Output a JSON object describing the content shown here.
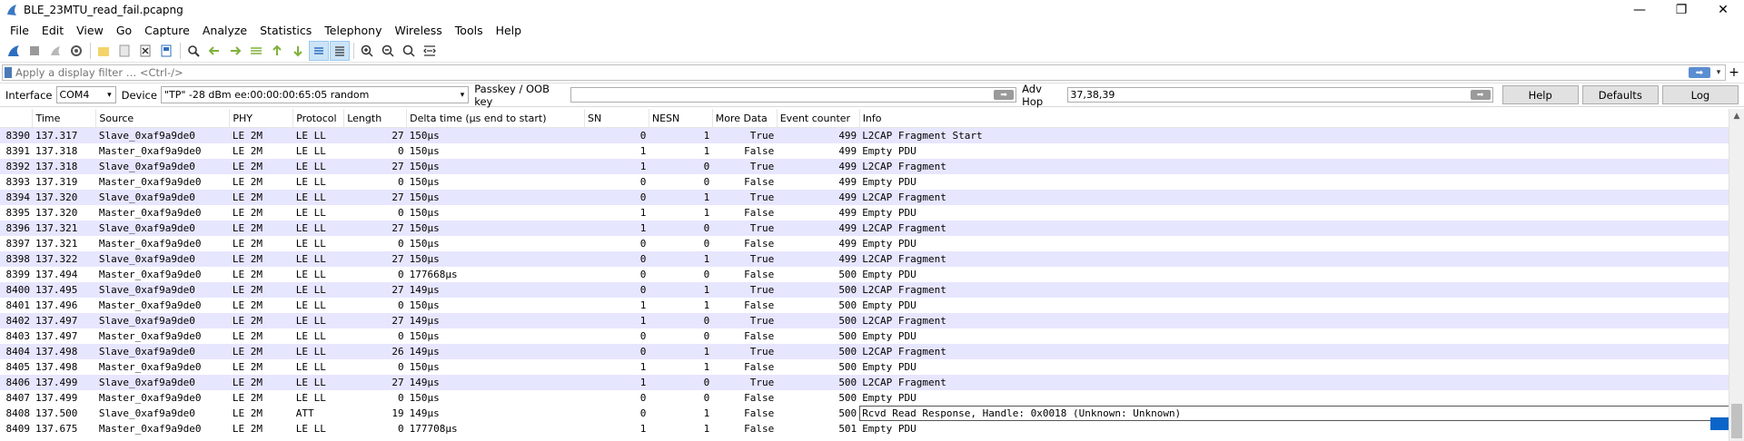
{
  "window": {
    "title": "BLE_23MTU_read_fail.pcapng",
    "controls": {
      "minimize": "—",
      "restore": "❐",
      "close": "✕"
    }
  },
  "menu": [
    "File",
    "Edit",
    "View",
    "Go",
    "Capture",
    "Analyze",
    "Statistics",
    "Telephony",
    "Wireless",
    "Tools",
    "Help"
  ],
  "toolbar": {
    "icons": [
      "shark-fin-start-icon",
      "stop-square-icon",
      "restart-icon",
      "options-gear-icon",
      "open-folder-icon",
      "save-file-icon",
      "close-file-icon",
      "reload-icon",
      "find-icon",
      "go-back-icon",
      "go-forward-icon",
      "go-to-packet-icon",
      "go-first-icon",
      "go-last-icon",
      "autoscroll-icon",
      "colorize-icon",
      "zoom-in-icon",
      "zoom-out-icon",
      "zoom-reset-icon",
      "resize-columns-icon"
    ]
  },
  "filter": {
    "placeholder": "Apply a display filter … <Ctrl-/>",
    "apply_arrow": "➡",
    "dropdown": "▾",
    "add": "+"
  },
  "interface_bar": {
    "interface_label": "Interface",
    "interface_value": "COM4",
    "device_label": "Device",
    "device_value": "\"TP\"  -28 dBm  ee:00:00:00:65:05  random",
    "passkey_label": "Passkey / OOB key",
    "passkey_value": "",
    "adv_hop_label": "Adv Hop",
    "adv_hop_value": "37,38,39",
    "help_button": "Help",
    "defaults_button": "Defaults",
    "log_button": "Log",
    "arrow": "➡"
  },
  "packet_list": {
    "columns": [
      "",
      "Time",
      "Source",
      "PHY",
      "Protocol",
      "Length",
      "Delta time (µs end to start)",
      "SN",
      "NESN",
      "More Data",
      "Event counter",
      "Info"
    ],
    "rows": [
      [
        "8390",
        "137.317",
        "Slave_0xaf9a9de0",
        "LE 2M",
        "LE LL",
        "27",
        "150µs",
        "0",
        "1",
        "True",
        "499",
        "L2CAP Fragment Start"
      ],
      [
        "8391",
        "137.318",
        "Master_0xaf9a9de0",
        "LE 2M",
        "LE LL",
        "0",
        "150µs",
        "1",
        "1",
        "False",
        "499",
        "Empty PDU"
      ],
      [
        "8392",
        "137.318",
        "Slave_0xaf9a9de0",
        "LE 2M",
        "LE LL",
        "27",
        "150µs",
        "1",
        "0",
        "True",
        "499",
        "L2CAP Fragment"
      ],
      [
        "8393",
        "137.319",
        "Master_0xaf9a9de0",
        "LE 2M",
        "LE LL",
        "0",
        "150µs",
        "0",
        "0",
        "False",
        "499",
        "Empty PDU"
      ],
      [
        "8394",
        "137.320",
        "Slave_0xaf9a9de0",
        "LE 2M",
        "LE LL",
        "27",
        "150µs",
        "0",
        "1",
        "True",
        "499",
        "L2CAP Fragment"
      ],
      [
        "8395",
        "137.320",
        "Master_0xaf9a9de0",
        "LE 2M",
        "LE LL",
        "0",
        "150µs",
        "1",
        "1",
        "False",
        "499",
        "Empty PDU"
      ],
      [
        "8396",
        "137.321",
        "Slave_0xaf9a9de0",
        "LE 2M",
        "LE LL",
        "27",
        "150µs",
        "1",
        "0",
        "True",
        "499",
        "L2CAP Fragment"
      ],
      [
        "8397",
        "137.321",
        "Master_0xaf9a9de0",
        "LE 2M",
        "LE LL",
        "0",
        "150µs",
        "0",
        "0",
        "False",
        "499",
        "Empty PDU"
      ],
      [
        "8398",
        "137.322",
        "Slave_0xaf9a9de0",
        "LE 2M",
        "LE LL",
        "27",
        "150µs",
        "0",
        "1",
        "True",
        "499",
        "L2CAP Fragment"
      ],
      [
        "8399",
        "137.494",
        "Master_0xaf9a9de0",
        "LE 2M",
        "LE LL",
        "0",
        "177668µs",
        "0",
        "0",
        "False",
        "500",
        "Empty PDU"
      ],
      [
        "8400",
        "137.495",
        "Slave_0xaf9a9de0",
        "LE 2M",
        "LE LL",
        "27",
        "149µs",
        "0",
        "1",
        "True",
        "500",
        "L2CAP Fragment"
      ],
      [
        "8401",
        "137.496",
        "Master_0xaf9a9de0",
        "LE 2M",
        "LE LL",
        "0",
        "150µs",
        "1",
        "1",
        "False",
        "500",
        "Empty PDU"
      ],
      [
        "8402",
        "137.497",
        "Slave_0xaf9a9de0",
        "LE 2M",
        "LE LL",
        "27",
        "149µs",
        "1",
        "0",
        "True",
        "500",
        "L2CAP Fragment"
      ],
      [
        "8403",
        "137.497",
        "Master_0xaf9a9de0",
        "LE 2M",
        "LE LL",
        "0",
        "150µs",
        "0",
        "0",
        "False",
        "500",
        "Empty PDU"
      ],
      [
        "8404",
        "137.498",
        "Slave_0xaf9a9de0",
        "LE 2M",
        "LE LL",
        "26",
        "149µs",
        "0",
        "1",
        "True",
        "500",
        "L2CAP Fragment"
      ],
      [
        "8405",
        "137.498",
        "Master_0xaf9a9de0",
        "LE 2M",
        "LE LL",
        "0",
        "150µs",
        "1",
        "1",
        "False",
        "500",
        "Empty PDU"
      ],
      [
        "8406",
        "137.499",
        "Slave_0xaf9a9de0",
        "LE 2M",
        "LE LL",
        "27",
        "149µs",
        "1",
        "0",
        "True",
        "500",
        "L2CAP Fragment"
      ],
      [
        "8407",
        "137.499",
        "Master_0xaf9a9de0",
        "LE 2M",
        "LE LL",
        "0",
        "150µs",
        "0",
        "0",
        "False",
        "500",
        "Empty PDU"
      ],
      [
        "8408",
        "137.500",
        "Slave_0xaf9a9de0",
        "LE 2M",
        "ATT",
        "19",
        "149µs",
        "0",
        "1",
        "False",
        "500",
        "Rcvd Read Response, Handle: 0x0018 (Unknown: Unknown)"
      ],
      [
        "8409",
        "137.675",
        "Master_0xaf9a9de0",
        "LE 2M",
        "LE LL",
        "0",
        "177708µs",
        "1",
        "1",
        "False",
        "501",
        "Empty PDU"
      ]
    ]
  },
  "scrollbar": {
    "up_arrow": "▲"
  },
  "colors": {
    "ll_row": "#e7e6ff",
    "selection_marker": "#0b65c9",
    "accent": "#4a7ab8"
  }
}
